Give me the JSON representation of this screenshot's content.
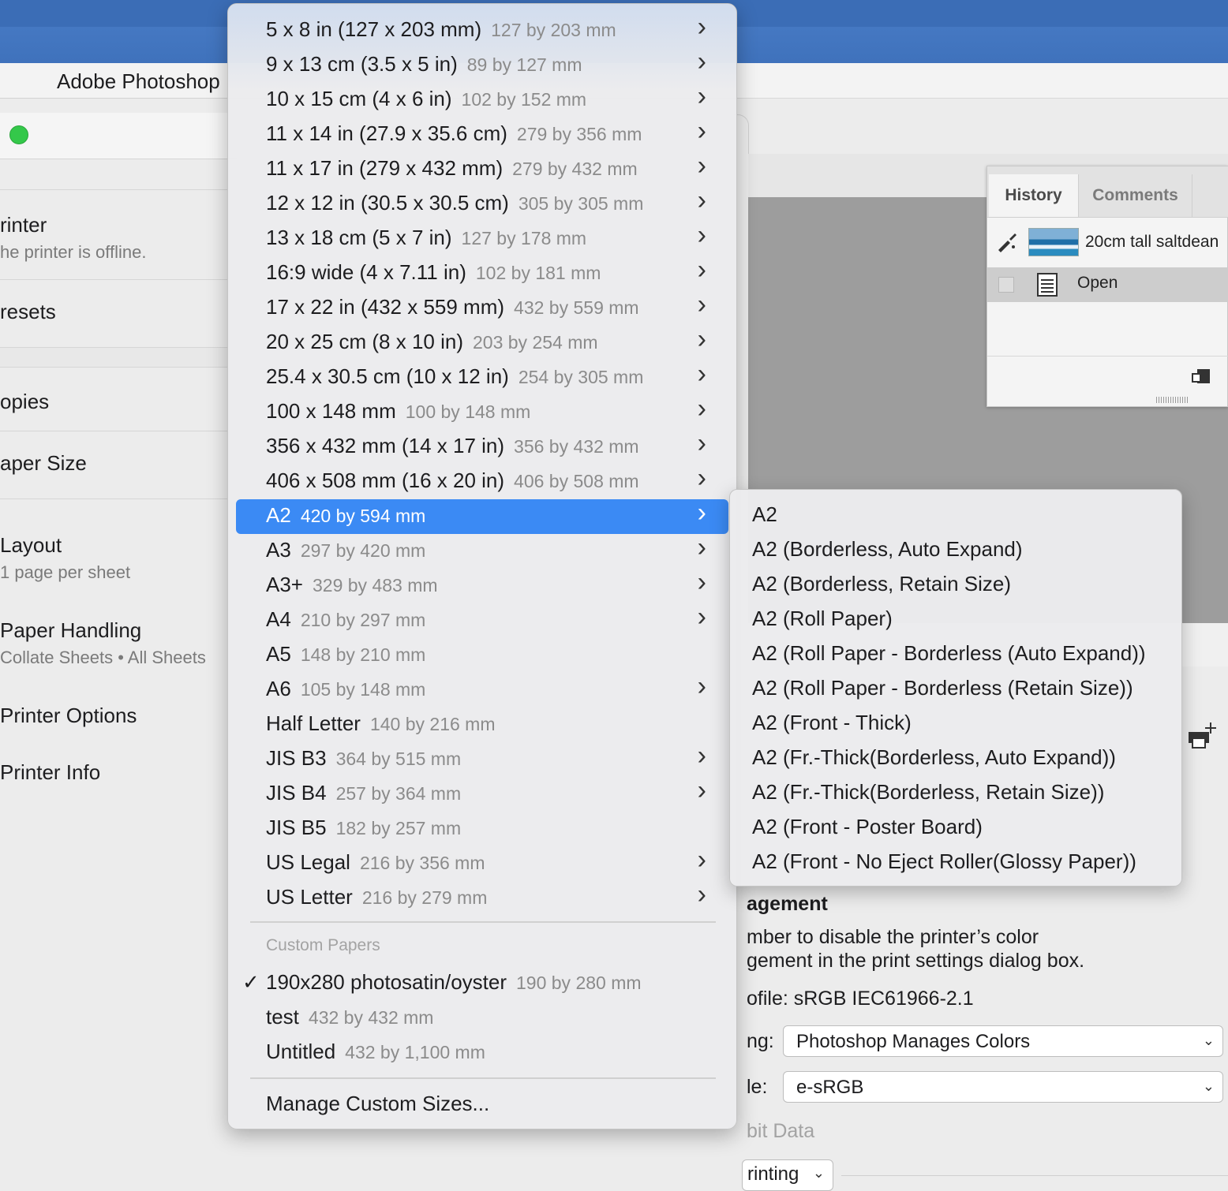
{
  "app": {
    "name": "Adobe Photoshop"
  },
  "print_dialog": {
    "sections": [
      {
        "label": "rinter",
        "sub": "he printer is offline."
      },
      {
        "label": "resets",
        "sub": ""
      },
      {
        "label": "opies",
        "sub": ""
      },
      {
        "label": "aper Size",
        "sub": ""
      },
      {
        "label": "Layout",
        "sub": "1 page per sheet"
      },
      {
        "label": "Paper Handling",
        "sub": "Collate Sheets • All Sheets"
      },
      {
        "label": "Printer Options",
        "sub": ""
      },
      {
        "label": "Printer Info",
        "sub": ""
      }
    ]
  },
  "history_panel": {
    "tabs": [
      "History",
      "Comments"
    ],
    "snapshot": "20cm tall saltdean",
    "states": [
      "Open"
    ]
  },
  "color_management": {
    "heading": "agement",
    "line1": "mber to disable the printer’s color",
    "line2": "gement in the print settings dialog box.",
    "profile": "ofile: sRGB IEC61966-2.1",
    "handling_label": "ng:",
    "handling_value": "Photoshop Manages Colors",
    "printer_profile_label": "le:",
    "printer_profile_value": "e-sRGB",
    "bit_data": "bit Data",
    "printing_select": "rinting"
  },
  "paper_menu": {
    "items": [
      {
        "name": "5 x 8 in (127 x 203 mm)",
        "dims": "127 by 203 mm",
        "submenu": true
      },
      {
        "name": "9 x 13 cm (3.5 x 5 in)",
        "dims": "89 by 127 mm",
        "submenu": true
      },
      {
        "name": "10 x 15 cm (4 x 6 in)",
        "dims": "102 by 152 mm",
        "submenu": true
      },
      {
        "name": "11 x 14 in (27.9 x 35.6 cm)",
        "dims": "279 by 356 mm",
        "submenu": true
      },
      {
        "name": "11 x 17 in (279 x 432 mm)",
        "dims": "279 by 432 mm",
        "submenu": true
      },
      {
        "name": "12 x 12 in (30.5 x 30.5 cm)",
        "dims": "305 by 305 mm",
        "submenu": true
      },
      {
        "name": "13 x 18 cm (5 x 7 in)",
        "dims": "127 by 178 mm",
        "submenu": true
      },
      {
        "name": "16:9 wide (4 x 7.11 in)",
        "dims": "102 by 181 mm",
        "submenu": true
      },
      {
        "name": "17 x 22 in (432 x 559 mm)",
        "dims": "432 by 559 mm",
        "submenu": true
      },
      {
        "name": "20 x 25 cm (8 x 10 in)",
        "dims": "203 by 254 mm",
        "submenu": true
      },
      {
        "name": "25.4 x 30.5 cm (10 x 12 in)",
        "dims": "254 by 305 mm",
        "submenu": true
      },
      {
        "name": "100 x 148 mm",
        "dims": "100 by 148 mm",
        "submenu": true
      },
      {
        "name": "356 x 432 mm (14 x 17 in)",
        "dims": "356 by 432 mm",
        "submenu": true
      },
      {
        "name": "406 x 508 mm (16 x 20 in)",
        "dims": "406 by 508 mm",
        "submenu": true
      },
      {
        "name": "A2",
        "dims": "420 by 594 mm",
        "submenu": true,
        "selected": true
      },
      {
        "name": "A3",
        "dims": "297 by 420 mm",
        "submenu": true
      },
      {
        "name": "A3+",
        "dims": "329 by 483 mm",
        "submenu": true
      },
      {
        "name": "A4",
        "dims": "210 by 297 mm",
        "submenu": true
      },
      {
        "name": "A5",
        "dims": "148 by 210 mm",
        "submenu": false
      },
      {
        "name": "A6",
        "dims": "105 by 148 mm",
        "submenu": true
      },
      {
        "name": "Half Letter",
        "dims": "140 by 216 mm",
        "submenu": false
      },
      {
        "name": "JIS B3",
        "dims": "364 by 515 mm",
        "submenu": true
      },
      {
        "name": "JIS B4",
        "dims": "257 by 364 mm",
        "submenu": true
      },
      {
        "name": "JIS B5",
        "dims": "182 by 257 mm",
        "submenu": false
      },
      {
        "name": "US Legal",
        "dims": "216 by 356 mm",
        "submenu": true
      },
      {
        "name": "US Letter",
        "dims": "216 by 279 mm",
        "submenu": true
      }
    ],
    "custom_header": "Custom Papers",
    "custom_items": [
      {
        "name": "190x280 photosatin/oyster",
        "dims": "190 by 280 mm",
        "checked": true
      },
      {
        "name": "test",
        "dims": "432 by 432 mm",
        "checked": false
      },
      {
        "name": "Untitled",
        "dims": "432 by 1,100 mm",
        "checked": false
      }
    ],
    "manage_label": "Manage Custom Sizes..."
  },
  "a2_submenu": {
    "items": [
      "A2",
      "A2 (Borderless, Auto Expand)",
      "A2 (Borderless, Retain Size)",
      "A2 (Roll Paper)",
      "A2 (Roll Paper - Borderless (Auto Expand))",
      "A2 (Roll Paper - Borderless (Retain Size))",
      "A2 (Front - Thick)",
      "A2 (Fr.-Thick(Borderless, Auto Expand))",
      "A2 (Fr.-Thick(Borderless, Retain Size))",
      "A2 (Front - Poster Board)",
      "A2 (Front - No Eject Roller(Glossy Paper))"
    ]
  },
  "colors": {
    "accent": "#3b8af4",
    "desktop": "#3f72bc",
    "status_green": "#34c84a"
  }
}
